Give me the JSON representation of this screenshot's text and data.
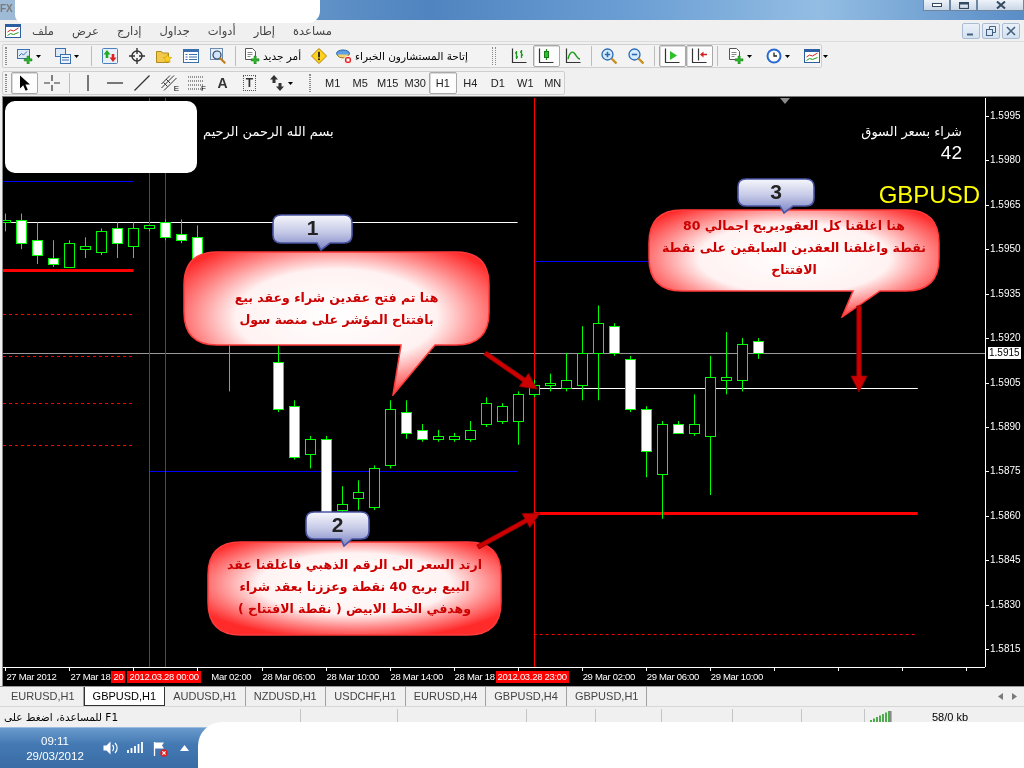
{
  "title_bar": {
    "logo": "FX"
  },
  "menu": {
    "items": [
      "مساعدة",
      "إطار",
      "أدوات",
      "جداول",
      "إدارج",
      "عرض",
      "ملف"
    ]
  },
  "toolbar_main": {
    "items": [
      {
        "kind": "templates",
        "dropdown": true
      },
      {
        "kind": "periods",
        "dropdown": true
      },
      {
        "kind": "indicators",
        "dropdown": true
      },
      {
        "kind": "separator"
      },
      {
        "kind": "chart_shift",
        "on": true
      },
      {
        "kind": "auto_scroll",
        "on": true
      },
      {
        "kind": "separator"
      },
      {
        "kind": "zoom_out"
      },
      {
        "kind": "zoom_in"
      },
      {
        "kind": "separator"
      },
      {
        "kind": "line_chart",
        "selected": false
      },
      {
        "kind": "candle_chart",
        "selected": true
      },
      {
        "kind": "bar_chart",
        "selected": false
      },
      {
        "kind": "grip"
      },
      {
        "kind": "experts",
        "label": "إتاحة المستشارون الخبراء"
      },
      {
        "kind": "warning"
      },
      {
        "kind": "new_order",
        "label": "أمر جديد"
      },
      {
        "kind": "separator"
      },
      {
        "kind": "tester"
      },
      {
        "kind": "terminal"
      },
      {
        "kind": "favorites"
      },
      {
        "kind": "navigator"
      },
      {
        "kind": "market_watch"
      },
      {
        "kind": "separator"
      },
      {
        "kind": "profiles",
        "dropdown": true
      },
      {
        "kind": "new_chart",
        "dropdown": true
      }
    ]
  },
  "toolbar_tools": {
    "items": [
      {
        "kind": "arrows",
        "dropdown": true,
        "selected": false
      },
      {
        "kind": "label",
        "letter": "T",
        "selected": false
      },
      {
        "kind": "text",
        "letter": "A",
        "selected": false
      },
      {
        "kind": "fibo_grid",
        "letter": "F",
        "selected": false
      },
      {
        "kind": "fibo",
        "letter": "E",
        "selected": false
      },
      {
        "kind": "trendline",
        "selected": false
      },
      {
        "kind": "hline",
        "selected": false
      },
      {
        "kind": "vline",
        "selected": false
      },
      {
        "kind": "separator"
      },
      {
        "kind": "crosshair",
        "selected": false
      },
      {
        "kind": "cursor",
        "selected": true
      }
    ]
  },
  "timeframes": [
    {
      "label": "MN",
      "selected": false
    },
    {
      "label": "W1",
      "selected": false
    },
    {
      "label": "D1",
      "selected": false
    },
    {
      "label": "H4",
      "selected": false
    },
    {
      "label": "H1",
      "selected": true
    },
    {
      "label": "M30",
      "selected": false
    },
    {
      "label": "M15",
      "selected": false
    },
    {
      "label": "M5",
      "selected": false
    },
    {
      "label": "M1",
      "selected": false
    }
  ],
  "chart": {
    "caption": "بسم الله الرحمن الرحيم",
    "order_caption": "شراء بسعر السوق",
    "order_value": "42",
    "symbol": "GBPUSD",
    "price_axis": {
      "labels": [
        "1.5995",
        "1.5980",
        "1.5965",
        "1.5950",
        "1.5935",
        "1.5920",
        "1.5905",
        "1.5890",
        "1.5875",
        "1.5860",
        "1.5845",
        "1.5830",
        "1.5815"
      ],
      "current": "1.5915"
    },
    "time_axis": {
      "labels": [
        {
          "text": "29 Mar 10:00",
          "kind": "tick"
        },
        {
          "text": "29 Mar 06:00",
          "kind": "tick"
        },
        {
          "text": "29 Mar 02:00",
          "kind": "tick"
        },
        {
          "text": "2012.03.28 23:00",
          "kind": "marker"
        },
        {
          "text": "28 Mar 18",
          "kind": "tick"
        },
        {
          "text": "28 Mar 14:00",
          "kind": "tick"
        },
        {
          "text": "28 Mar 10:00",
          "kind": "tick"
        },
        {
          "text": "28 Mar 06:00",
          "kind": "tick"
        },
        {
          "text": "Mar 02:00",
          "kind": "tick"
        },
        {
          "text": "2012.03.28 00:00",
          "kind": "marker"
        },
        {
          "text": "20",
          "kind": "marker"
        },
        {
          "text": "27 Mar 18",
          "kind": "tick"
        },
        {
          "text": "27 Mar 2012",
          "kind": "tick"
        }
      ]
    },
    "callouts": [
      {
        "number": "1",
        "text": "هنا تم فتح عقدين شراء وعقد بيع\nبافتتاح المؤشر على منصة سول"
      },
      {
        "number": "2",
        "text": "ارتد السعر الى الرقم الذهبي فاغلقنا عقد\nالبيع بربح 40 نقطة وعززنا بعقد شراء\nوهدفي الخط الابيض ( نقطة الافتتاح )"
      },
      {
        "number": "3",
        "text": "هنا اغلقنا كل العقوديربح اجمالي 80\nنقطة واغلقنا العقدين السابقين على نقطة\nالافتتاح"
      }
    ]
  },
  "chart_tabs": [
    {
      "label": "GBPUSD,H1",
      "selected": false
    },
    {
      "label": "GBPUSD,H4",
      "selected": false
    },
    {
      "label": "EURUSD,H4",
      "selected": false
    },
    {
      "label": "USDCHF,H1",
      "selected": false
    },
    {
      "label": "NZDUSD,H1",
      "selected": false
    },
    {
      "label": "AUDUSD,H1",
      "selected": false
    },
    {
      "label": "GBPUSD,H1",
      "selected": true
    },
    {
      "label": "EURUSD,H1",
      "selected": false
    }
  ],
  "status_bar": {
    "help": "للمساعدة، اضغط على F1",
    "traffic": "58/0 kb"
  },
  "taskbar": {
    "time": "09:11",
    "date": "29/03/2012"
  }
}
